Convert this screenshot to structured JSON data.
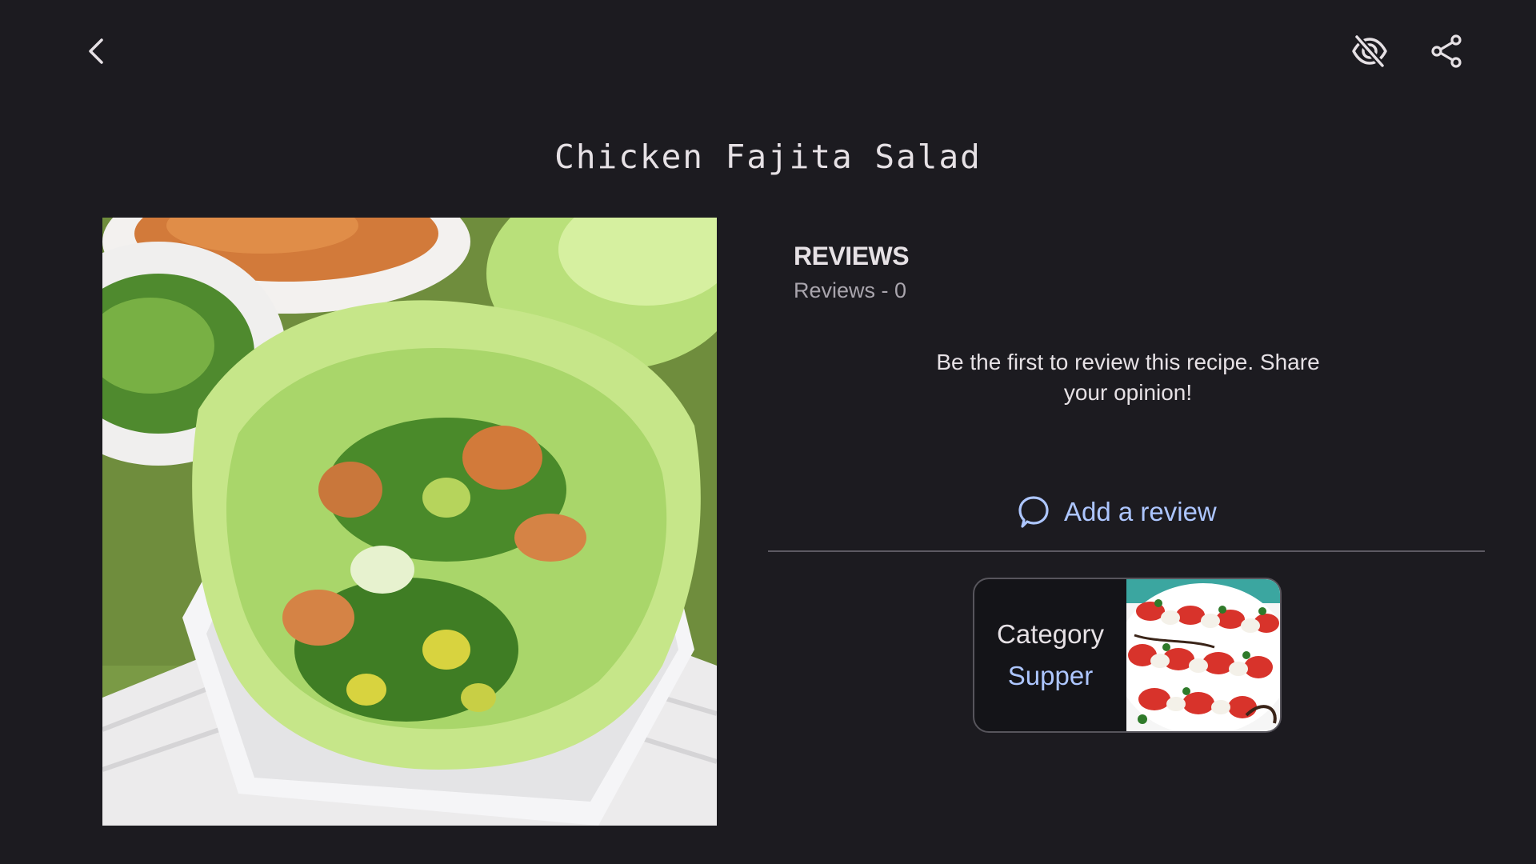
{
  "toolbar": {
    "back_icon": "chevron-left-icon",
    "hide_icon": "eye-off-icon",
    "share_icon": "share-icon"
  },
  "recipe": {
    "title": "Chicken Fajita Salad",
    "image_alt": "lettuce-wrap-photo"
  },
  "reviews": {
    "heading": "REVIEWS",
    "count_text": "Reviews - 0",
    "empty_message": "Be the first to review this recipe. Share your opinion!",
    "add_label": "Add a review",
    "add_icon": "comment-icon"
  },
  "category": {
    "label": "Category",
    "value": "Supper",
    "thumb": "caprese-salad-photo"
  },
  "colors": {
    "background": "#1c1b20",
    "accent": "#adc6ff",
    "text": "#e6e1e5",
    "muted": "#a9a5ad"
  }
}
